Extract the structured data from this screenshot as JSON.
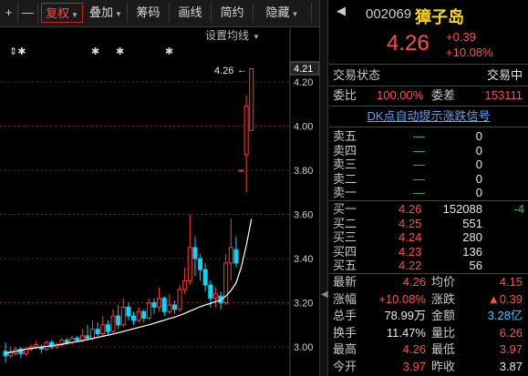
{
  "toolbar": {
    "plus": "+",
    "minus": "—",
    "fuquan": "复权",
    "diejia": "叠加",
    "chouma": "筹码",
    "huaxian": "画线",
    "jianyue": "简约",
    "yincang": "隐藏"
  },
  "chart": {
    "settings_label": "设置均线",
    "markers": [
      "⇕✱",
      "✱",
      "✱",
      "✱"
    ],
    "price_tag": "4.26",
    "price_tag_arrow": "←",
    "current_price_box": "4.21",
    "y_labels": [
      "4.20",
      "4.00",
      "3.80",
      "3.60",
      "3.40",
      "3.20",
      "3.00"
    ],
    "colors": {
      "up": "#ff3b3b",
      "down": "#00d8ff",
      "ma": "#ffffff"
    }
  },
  "chart_data": {
    "type": "candlestick",
    "ylim": [
      2.93,
      4.27
    ],
    "candles": [
      {
        "o": 2.98,
        "c": 2.96,
        "h": 3.02,
        "l": 2.93
      },
      {
        "o": 2.96,
        "c": 2.98,
        "h": 3.0,
        "l": 2.95
      },
      {
        "o": 2.97,
        "c": 2.99,
        "h": 3.0,
        "l": 2.96
      },
      {
        "o": 2.99,
        "c": 2.97,
        "h": 3.0,
        "l": 2.95
      },
      {
        "o": 2.97,
        "c": 2.99,
        "h": 3.0,
        "l": 2.96
      },
      {
        "o": 2.99,
        "c": 3.0,
        "h": 3.01,
        "l": 2.98
      },
      {
        "o": 3.0,
        "c": 3.01,
        "h": 3.03,
        "l": 2.99
      },
      {
        "o": 3.0,
        "c": 2.99,
        "h": 3.01,
        "l": 2.97
      },
      {
        "o": 2.99,
        "c": 3.02,
        "h": 3.03,
        "l": 2.98
      },
      {
        "o": 3.02,
        "c": 3.0,
        "h": 3.03,
        "l": 2.99
      },
      {
        "o": 3.0,
        "c": 3.01,
        "h": 3.02,
        "l": 2.99
      },
      {
        "o": 3.01,
        "c": 3.03,
        "h": 3.04,
        "l": 3.0
      },
      {
        "o": 3.03,
        "c": 3.02,
        "h": 3.04,
        "l": 3.01
      },
      {
        "o": 3.02,
        "c": 3.04,
        "h": 3.05,
        "l": 3.01
      },
      {
        "o": 3.04,
        "c": 3.03,
        "h": 3.05,
        "l": 3.02
      },
      {
        "o": 3.03,
        "c": 3.05,
        "h": 3.08,
        "l": 3.02
      },
      {
        "o": 3.05,
        "c": 3.04,
        "h": 3.1,
        "l": 3.03
      },
      {
        "o": 3.04,
        "c": 3.08,
        "h": 3.12,
        "l": 3.03
      },
      {
        "o": 3.08,
        "c": 3.06,
        "h": 3.11,
        "l": 3.04
      },
      {
        "o": 3.06,
        "c": 3.1,
        "h": 3.14,
        "l": 3.05
      },
      {
        "o": 3.1,
        "c": 3.07,
        "h": 3.12,
        "l": 3.05
      },
      {
        "o": 3.07,
        "c": 3.14,
        "h": 3.17,
        "l": 3.06
      },
      {
        "o": 3.14,
        "c": 3.1,
        "h": 3.19,
        "l": 3.08
      },
      {
        "o": 3.1,
        "c": 3.18,
        "h": 3.22,
        "l": 3.09
      },
      {
        "o": 3.18,
        "c": 3.14,
        "h": 3.2,
        "l": 3.12
      },
      {
        "o": 3.14,
        "c": 3.12,
        "h": 3.16,
        "l": 3.1
      },
      {
        "o": 3.12,
        "c": 3.16,
        "h": 3.18,
        "l": 3.11
      },
      {
        "o": 3.16,
        "c": 3.13,
        "h": 3.17,
        "l": 3.11
      },
      {
        "o": 3.13,
        "c": 3.2,
        "h": 3.22,
        "l": 3.12
      },
      {
        "o": 3.2,
        "c": 3.18,
        "h": 3.22,
        "l": 3.15
      },
      {
        "o": 3.18,
        "c": 3.22,
        "h": 3.27,
        "l": 3.16
      },
      {
        "o": 3.22,
        "c": 3.16,
        "h": 3.23,
        "l": 3.14
      },
      {
        "o": 3.16,
        "c": 3.19,
        "h": 3.24,
        "l": 3.15
      },
      {
        "o": 3.19,
        "c": 3.17,
        "h": 3.21,
        "l": 3.15
      },
      {
        "o": 3.17,
        "c": 3.26,
        "h": 3.28,
        "l": 3.16
      },
      {
        "o": 3.26,
        "c": 3.3,
        "h": 3.36,
        "l": 3.24
      },
      {
        "o": 3.3,
        "c": 3.45,
        "h": 3.6,
        "l": 3.28
      },
      {
        "o": 3.45,
        "c": 3.4,
        "h": 3.5,
        "l": 3.32
      },
      {
        "o": 3.4,
        "c": 3.35,
        "h": 3.42,
        "l": 3.3
      },
      {
        "o": 3.35,
        "c": 3.28,
        "h": 3.38,
        "l": 3.25
      },
      {
        "o": 3.28,
        "c": 3.22,
        "h": 3.3,
        "l": 3.18
      },
      {
        "o": 3.22,
        "c": 3.24,
        "h": 3.27,
        "l": 3.18
      },
      {
        "o": 3.23,
        "c": 3.2,
        "h": 3.25,
        "l": 3.17
      },
      {
        "o": 3.2,
        "c": 3.38,
        "h": 3.42,
        "l": 3.19
      },
      {
        "o": 3.38,
        "c": 3.45,
        "h": 3.58,
        "l": 3.3
      },
      {
        "o": 3.44,
        "c": 3.38,
        "h": 3.5,
        "l": 3.36
      },
      {
        "o": 3.8,
        "c": 3.8,
        "h": 3.8,
        "l": 3.8
      },
      {
        "o": 3.87,
        "c": 4.09,
        "h": 4.14,
        "l": 3.7
      },
      {
        "o": 3.98,
        "c": 4.26,
        "h": 4.26,
        "l": 3.98
      }
    ],
    "ma": [
      2.97,
      2.975,
      2.98,
      2.985,
      2.99,
      2.993,
      2.996,
      2.999,
      3.002,
      3.005,
      3.008,
      3.012,
      3.016,
      3.02,
      3.024,
      3.028,
      3.033,
      3.038,
      3.043,
      3.048,
      3.053,
      3.058,
      3.064,
      3.07,
      3.076,
      3.082,
      3.088,
      3.094,
      3.1,
      3.107,
      3.114,
      3.121,
      3.128,
      3.135,
      3.143,
      3.152,
      3.162,
      3.172,
      3.182,
      3.19,
      3.197,
      3.205,
      3.212,
      3.23,
      3.255,
      3.29,
      3.36,
      3.46,
      3.58
    ]
  },
  "quote": {
    "code": "002069",
    "name": "獐子岛",
    "price": "4.26",
    "change": "+0.39",
    "change_pct": "+10.08%",
    "status_label": "交易状态",
    "status_value": "交易中",
    "weibi_label": "委比",
    "weibi_value": "100.00%",
    "weicha_label": "委差",
    "weicha_value": "153111",
    "signal_link": "DK点自动提示涨跌信号"
  },
  "sell": [
    {
      "label": "卖五",
      "price": "—",
      "vol": "0"
    },
    {
      "label": "卖四",
      "price": "—",
      "vol": "0"
    },
    {
      "label": "卖三",
      "price": "—",
      "vol": "0"
    },
    {
      "label": "卖二",
      "price": "—",
      "vol": "0"
    },
    {
      "label": "卖一",
      "price": "—",
      "vol": "0"
    }
  ],
  "buy": [
    {
      "label": "买一",
      "price": "4.26",
      "vol": "152088",
      "chg": "-4"
    },
    {
      "label": "买二",
      "price": "4.25",
      "vol": "551",
      "chg": ""
    },
    {
      "label": "买三",
      "price": "4.24",
      "vol": "280",
      "chg": ""
    },
    {
      "label": "买四",
      "price": "4.23",
      "vol": "136",
      "chg": ""
    },
    {
      "label": "买五",
      "price": "4.22",
      "vol": "56",
      "chg": ""
    }
  ],
  "stats": [
    {
      "l1": "最新",
      "v1": "4.26",
      "c1": "red",
      "l2": "均价",
      "v2": "4.15",
      "c2": "red"
    },
    {
      "l1": "涨幅",
      "v1": "+10.08%",
      "c1": "red",
      "l2": "涨跌",
      "v2": "▲0.39",
      "c2": "red"
    },
    {
      "l1": "总手",
      "v1": "78.99万",
      "c1": "wht",
      "l2": "金额",
      "v2": "3.28亿",
      "c2": "cyan"
    },
    {
      "l1": "换手",
      "v1": "11.47%",
      "c1": "wht",
      "l2": "量比",
      "v2": "6.26",
      "c2": "red"
    },
    {
      "l1": "最高",
      "v1": "4.26",
      "c1": "red",
      "l2": "最低",
      "v2": "3.97",
      "c2": "red"
    },
    {
      "l1": "今开",
      "v1": "3.97",
      "c1": "red",
      "l2": "昨收",
      "v2": "3.87",
      "c2": "wht"
    }
  ],
  "sep_marker": "◀"
}
